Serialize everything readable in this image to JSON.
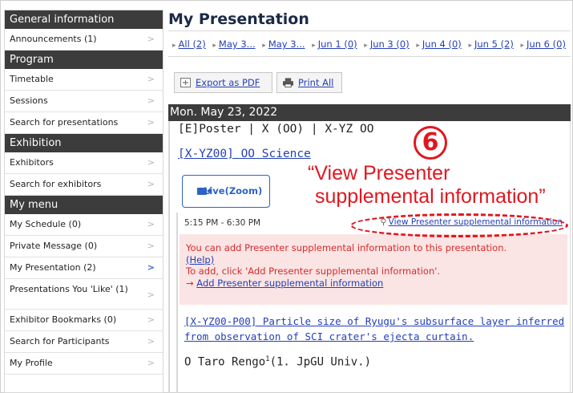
{
  "sidebar": {
    "sections": [
      {
        "heading": "General information",
        "items": [
          {
            "label": "Announcements (1)"
          }
        ]
      },
      {
        "heading": "Program",
        "items": [
          {
            "label": "Timetable"
          },
          {
            "label": "Sessions"
          },
          {
            "label": "Search for presentations"
          }
        ]
      },
      {
        "heading": "Exhibition",
        "items": [
          {
            "label": "Exhibitors"
          },
          {
            "label": "Search for exhibitors"
          }
        ]
      },
      {
        "heading": "My menu",
        "items": [
          {
            "label": "My Schedule (0)"
          },
          {
            "label": "Private Message (0)"
          },
          {
            "label": "My Presentation (2)"
          },
          {
            "label": "Presentations You 'Like' (1)"
          },
          {
            "label": "Exhibitor Bookmarks (0)"
          },
          {
            "label": "Search for Participants"
          },
          {
            "label": "My Profile"
          }
        ]
      }
    ],
    "chevron": ">",
    "active_item": "My Presentation (2)"
  },
  "main": {
    "title": "My Presentation",
    "tabs": [
      {
        "label": "All (2)"
      },
      {
        "label": "May 3..."
      },
      {
        "label": "May 3..."
      },
      {
        "label": "Jun 1 (0)"
      },
      {
        "label": "Jun 3 (0)"
      },
      {
        "label": "Jun 4 (0)"
      },
      {
        "label": "Jun 5 (2)"
      },
      {
        "label": "Jun 6 (0)"
      }
    ],
    "toolbar": {
      "export_label": "Export as PDF",
      "print_label": "Print All"
    },
    "day_header": "Mon. May 23, 2022",
    "session": {
      "type_line": "[E]Poster | X (OO)  | X-YZ OO",
      "link": "[X-YZ00] OO Science",
      "live_button": "Live(Zoom)"
    },
    "presentation": {
      "time": "5:15 PM - 6:30 PM",
      "supplemental_link": "View Presenter supplemental information",
      "notice_line1": "You can add Presenter supplemental information to this presentation.",
      "help_link": "(Help)",
      "notice_line2": "To add, click 'Add Presenter supplemental information'.",
      "add_arrow": "→",
      "add_link": "Add Presenter supplemental information",
      "title": "[X-YZ00-P00] Particle size of Ryugu's subsurface layer inferred from observation of SCI crater's ejecta curtain.",
      "author_name": "O Taro Rengo",
      "author_sup": "1",
      "author_affil": "(1. JpGU Univ.)"
    }
  },
  "annotation": {
    "number": "6",
    "line1": "“View Presenter",
    "line2": "supplemental information”",
    "color": "#e0171f"
  }
}
